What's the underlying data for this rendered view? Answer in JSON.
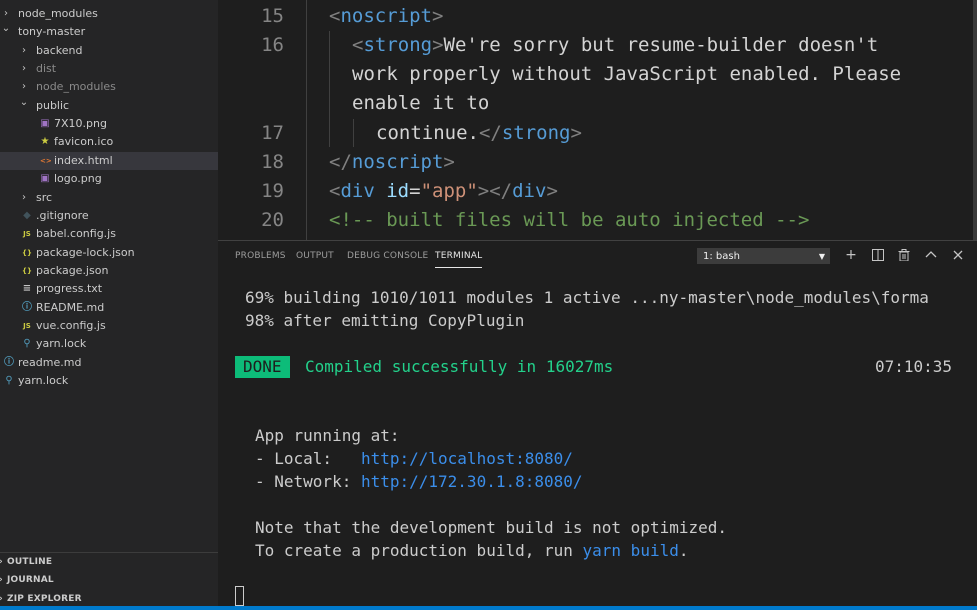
{
  "explorer": {
    "items": [
      {
        "label": "node_modules",
        "type": "folder",
        "expanded": false,
        "depth": 0
      },
      {
        "label": "tony-master",
        "type": "folder",
        "expanded": true,
        "depth": 0
      },
      {
        "label": "backend",
        "type": "folder",
        "expanded": false,
        "depth": 1
      },
      {
        "label": "dist",
        "type": "folder",
        "expanded": false,
        "depth": 1
      },
      {
        "label": "node_modules",
        "type": "folder",
        "expanded": false,
        "depth": 1
      },
      {
        "label": "public",
        "type": "folder",
        "expanded": true,
        "depth": 1
      },
      {
        "label": "7X10.png",
        "type": "image",
        "depth": 2
      },
      {
        "label": "favicon.ico",
        "type": "star",
        "depth": 2
      },
      {
        "label": "index.html",
        "type": "html",
        "depth": 2,
        "selected": true
      },
      {
        "label": "logo.png",
        "type": "image",
        "depth": 2
      },
      {
        "label": "src",
        "type": "folder",
        "expanded": false,
        "depth": 1
      },
      {
        "label": ".gitignore",
        "type": "git",
        "depth": 1
      },
      {
        "label": "babel.config.js",
        "type": "js",
        "depth": 1
      },
      {
        "label": "package-lock.json",
        "type": "json",
        "depth": 1
      },
      {
        "label": "package.json",
        "type": "json",
        "depth": 1
      },
      {
        "label": "progress.txt",
        "type": "text",
        "depth": 1
      },
      {
        "label": "README.md",
        "type": "info",
        "depth": 1
      },
      {
        "label": "vue.config.js",
        "type": "js",
        "depth": 1
      },
      {
        "label": "yarn.lock",
        "type": "yarn",
        "depth": 1
      },
      {
        "label": "readme.md",
        "type": "info",
        "depth": 0
      },
      {
        "label": "yarn.lock",
        "type": "yarn",
        "depth": 0
      }
    ],
    "sections": [
      "OUTLINE",
      "JOURNAL",
      "ZIP EXPLORER"
    ]
  },
  "editor": {
    "line_numbers": [
      "15",
      "16",
      "17",
      "18",
      "19",
      "20"
    ]
  },
  "panel": {
    "tabs": [
      "PROBLEMS",
      "OUTPUT",
      "DEBUG CONSOLE",
      "TERMINAL"
    ],
    "active_tab": "TERMINAL",
    "terminal_select": "1: bash",
    "icons": [
      "plus-icon",
      "split-icon",
      "trash-icon",
      "chevron-up-icon",
      "close-icon"
    ]
  },
  "terminal": {
    "line1": "69% building 1010/1011 modules 1 active ...ny-master\\node_modules\\forma",
    "line2": "98% after emitting CopyPlugin",
    "done_label": "DONE",
    "compiled_msg": "Compiled successfully in 16027ms",
    "timestamp": "07:10:35",
    "app_running": "App running at:",
    "local_label": "- Local:   ",
    "local_url": "http://localhost:8080/",
    "network_label": "- Network: ",
    "network_url": "http://172.30.1.8:8080/",
    "note1": "Note that the development build is not optimized.",
    "note2_pre": "To create a production build, run ",
    "note2_cmd": "yarn build",
    "note2_post": "."
  },
  "colors": {
    "sidebar_bg": "#252526",
    "editor_bg": "#1e1e1e",
    "selection": "#37373d",
    "done_badge": "#0dbc79",
    "success_text": "#23d18b",
    "link": "#3b8eea",
    "status_bar": "#007acc"
  }
}
